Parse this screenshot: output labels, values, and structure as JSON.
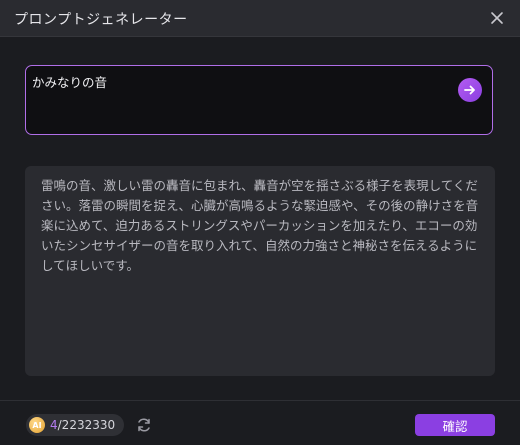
{
  "title": "プロンプトジェネレーター",
  "prompt": {
    "value": "かみなりの音"
  },
  "result": {
    "text": "雷鳴の音、激しい雷の轟音に包まれ、轟音が空を揺さぶる様子を表現してください。落雷の瞬間を捉え、心臓が高鳴るような緊迫感や、その後の静けさを音楽に込めて、迫力あるストリングスやパーカッションを加えたり、エコーの効いたシンセサイザーの音を取り入れて、自然の力強さと神秘さを伝えるようにしてほしいです。"
  },
  "footer": {
    "ai_badge": "AI",
    "credits_used": "4",
    "credits_total": "/2232330",
    "confirm_label": "確認"
  },
  "colors": {
    "accent": "#8b3fe2",
    "border_accent": "#b06ee8"
  }
}
